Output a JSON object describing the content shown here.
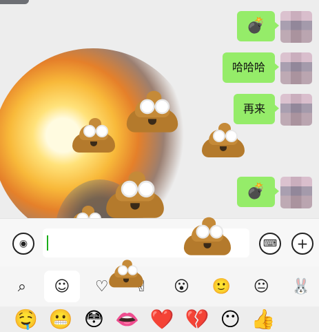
{
  "chat": {
    "messages": [
      {
        "type": "emoji",
        "icon": "bomb-icon"
      },
      {
        "type": "text",
        "text": "哈哈哈"
      },
      {
        "type": "text",
        "text": "再来"
      },
      {
        "type": "emoji",
        "icon": "bomb-icon"
      }
    ]
  },
  "tabs": [
    {
      "icon": "search-icon"
    },
    {
      "icon": "emoji-icon",
      "active": true
    },
    {
      "icon": "heart-icon"
    },
    {
      "icon": "peace-hand-icon"
    },
    {
      "icon": "smiley-sticker-icon"
    },
    {
      "icon": "mascot-sticker-icon"
    },
    {
      "icon": "pack-sticker-icon"
    },
    {
      "icon": "more-sticker-icon"
    }
  ],
  "emoji_row": [
    "🤤",
    "😬",
    "😳",
    "👄",
    "❤️",
    "💔",
    "😶",
    "👍"
  ]
}
